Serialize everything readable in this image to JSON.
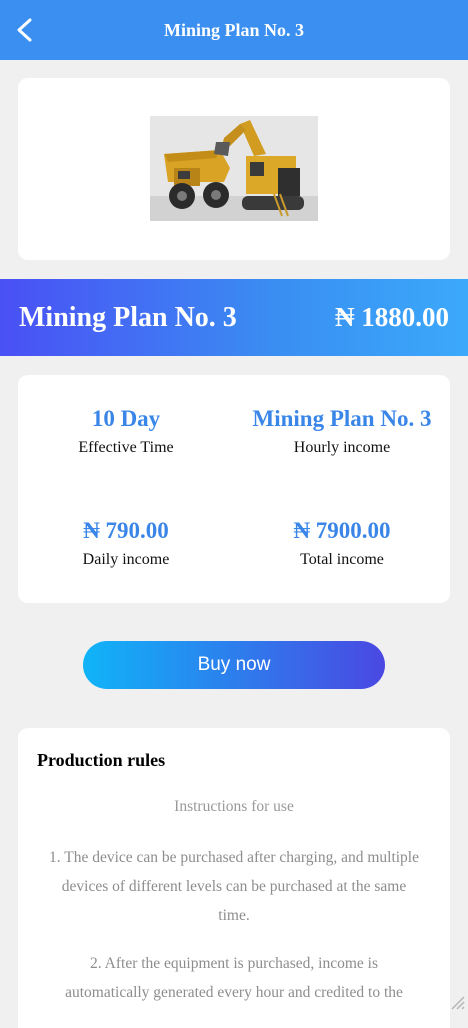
{
  "header": {
    "title": "Mining Plan No. 3",
    "back_icon": "chevron-left-icon"
  },
  "product": {
    "image_alt": "mining machinery"
  },
  "banner": {
    "name": "Mining Plan No. 3",
    "price": "₦ 1880.00"
  },
  "stats": [
    {
      "value": "10 Day",
      "label": "Effective Time"
    },
    {
      "value": "Mining Plan No. 3",
      "label": "Hourly income"
    },
    {
      "value": "₦ 790.00",
      "label": "Daily income"
    },
    {
      "value": "₦ 7900.00",
      "label": "Total income"
    }
  ],
  "buy_button": {
    "label": "Buy now"
  },
  "rules": {
    "title": "Production rules",
    "subtitle": "Instructions for use",
    "paragraphs": [
      "1. The device can be purchased after charging, and multiple devices of different levels can be purchased at the same time.",
      "2. After the equipment is purchased, income is automatically generated every hour and credited to the"
    ]
  },
  "colors": {
    "header_bg": "#3b8ff0",
    "accent_value": "#3a86e8",
    "banner_gradient_start": "#4a50f5",
    "banner_gradient_end": "#3ba9fb",
    "button_gradient_start": "#10b4f8",
    "button_gradient_end": "#4a48e2"
  }
}
